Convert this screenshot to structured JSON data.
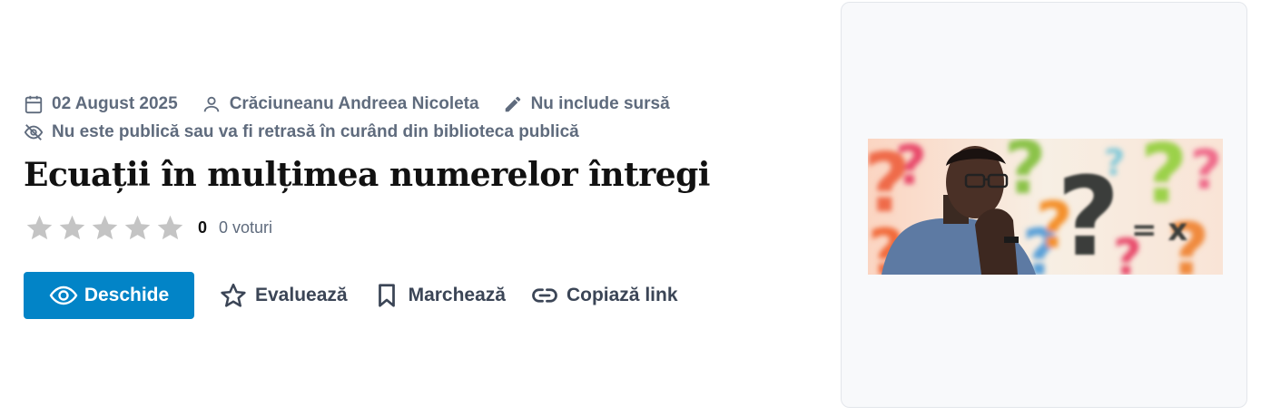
{
  "meta": {
    "date": "02 August 2025",
    "author": "Crăciuneanu Andreea Nicoleta",
    "source": "Nu include sursă",
    "visibility": "Nu este publică sau va fi retrasă în curând din biblioteca publică"
  },
  "title": "Ecuații în mulțimea numerelor întregi",
  "rating": {
    "value": "0",
    "stars_filled": 0,
    "stars_total": 5,
    "votes": "0 voturi"
  },
  "actions": {
    "open": "Deschide",
    "rate": "Evaluează",
    "bookmark": "Marchează",
    "copy_link": "Copiază link"
  },
  "icons": [
    "calendar-icon",
    "user-icon",
    "pencil-icon",
    "eye-off-icon",
    "star-icon",
    "eye-icon",
    "bookmark-icon",
    "link-icon"
  ],
  "colors": {
    "primary": "#0284c7",
    "meta": "#5f6b7d",
    "star_empty": "#c4c4c4"
  },
  "cover": {
    "math_text": "= x"
  }
}
